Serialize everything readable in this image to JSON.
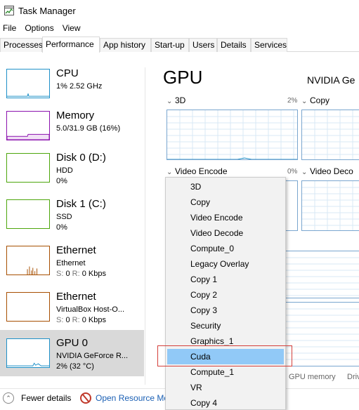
{
  "window": {
    "title": "Task Manager",
    "icon": "task-manager-icon"
  },
  "menu": [
    "File",
    "Options",
    "View"
  ],
  "tabs": [
    "Processes",
    "Performance",
    "App history",
    "Start-up",
    "Users",
    "Details",
    "Services"
  ],
  "active_tab": "Performance",
  "sidebar": [
    {
      "name": "CPU",
      "line1": "1% 2.52 GHz",
      "line2": "",
      "color": "#1e90c8"
    },
    {
      "name": "Memory",
      "line1": "5.0/31.9 GB (16%)",
      "line2": "",
      "color": "#8b12ae"
    },
    {
      "name": "Disk 0 (D:)",
      "line1": "HDD",
      "line2": "0%",
      "color": "#4da60c"
    },
    {
      "name": "Disk 1 (C:)",
      "line1": "SSD",
      "line2": "0%",
      "color": "#4da60c"
    },
    {
      "name": "Ethernet",
      "line1": "Ethernet",
      "line2_s": "S:",
      "line2_sv": " 0 ",
      "line2_r": "R:",
      "line2_rv": " 0 Kbps",
      "color": "#a74f01"
    },
    {
      "name": "Ethernet",
      "line1": "VirtualBox Host-O...",
      "line2_s": "S:",
      "line2_sv": " 0 ",
      "line2_r": "R:",
      "line2_rv": " 0 Kbps",
      "color": "#a74f01"
    },
    {
      "name": "GPU 0",
      "line1": "NVIDIA GeForce R...",
      "line2": "2% (32 °C)",
      "color": "#1e90c8"
    }
  ],
  "main": {
    "title": "GPU",
    "subtitle": "NVIDIA Ge",
    "engines": [
      {
        "label": "3D",
        "pct": "2%"
      },
      {
        "label": "Copy",
        "pct": ""
      },
      {
        "label": "Video Encode",
        "pct": "0%"
      },
      {
        "label": "Video Deco",
        "pct": ""
      }
    ],
    "bottom_labels": [
      "GPU memory",
      "Driv"
    ]
  },
  "dropdown": {
    "items": [
      "3D",
      "Copy",
      "Video Encode",
      "Video Decode",
      "Compute_0",
      "Legacy Overlay",
      "Copy 1",
      "Copy 2",
      "Copy 3",
      "Security",
      "Graphics_1",
      "Cuda",
      "Compute_1",
      "VR",
      "Copy 4"
    ],
    "highlighted": "Cuda"
  },
  "footer": {
    "fewer_details": "Fewer details",
    "open_resource_monitor": "Open Resource Mo"
  }
}
